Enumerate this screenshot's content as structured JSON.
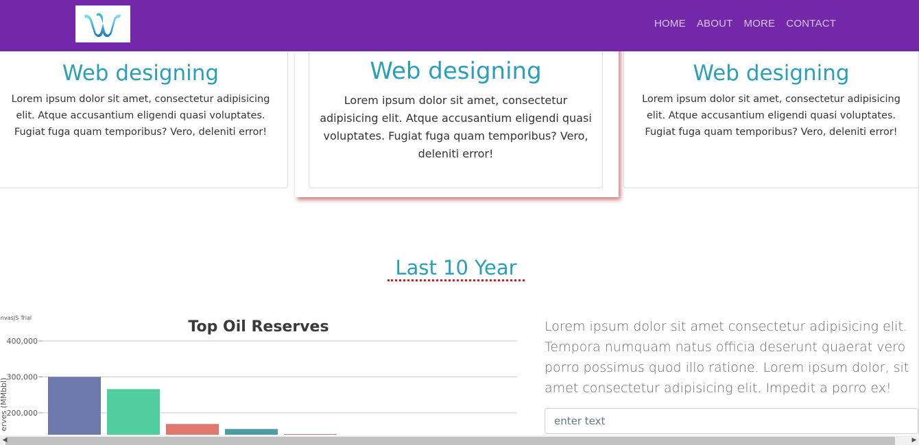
{
  "navbar": {
    "logo_icon": "w-ribbon-logo",
    "links": [
      "HOME",
      "ABOUT",
      "MORE",
      "CONTACT"
    ]
  },
  "cards": [
    {
      "title": "Web designing",
      "text": "Lorem ipsum dolor sit amet, consectetur adipisicing elit. Atque accusantium eligendi quasi voluptates. Fugiat fuga quam temporibus? Vero, deleniti error!"
    },
    {
      "title": "Web designing",
      "text": "Lorem ipsum dolor sit amet, consectetur adipisicing elit. Atque accusantium eligendi quasi voluptates. Fugiat fuga quam temporibus? Vero, deleniti error!"
    },
    {
      "title": "Web designing",
      "text": "Lorem ipsum dolor sit amet, consectetur adipisicing elit. Atque accusantium eligendi quasi voluptates. Fugiat fuga quam temporibus? Vero, deleniti error!"
    }
  ],
  "section": {
    "title": "Last 10 Year"
  },
  "chart_data": {
    "type": "bar",
    "title": "Top Oil Reserves",
    "watermark": "anvasJS Trial",
    "ylabel": "erves (MMbbl)",
    "ylim": [
      0,
      400000
    ],
    "yticks": [
      "400,000",
      "300,000",
      "200,000"
    ],
    "grid": true,
    "values": [
      300000,
      266000,
      169000,
      155000,
      141000
    ],
    "colors": [
      "#6d78ad",
      "#51cda0",
      "#df7970",
      "#4c9ca0",
      "#ae7d99"
    ]
  },
  "side": {
    "paragraph": "Lorem ipsum dolor sit amet consectetur adipisicing elit. Tempora numquam natus officia deserunt quaerat vero porro possimus quod illo ratione. Lorem ipsum dolor, sit amet consectetur adipisicing elit. Impedit a porro ex!",
    "input_placeholder": "enter text"
  },
  "colors": {
    "navbar": "#7328aa",
    "accent": "#2a9fb8",
    "underline": "#cc1d1d"
  }
}
